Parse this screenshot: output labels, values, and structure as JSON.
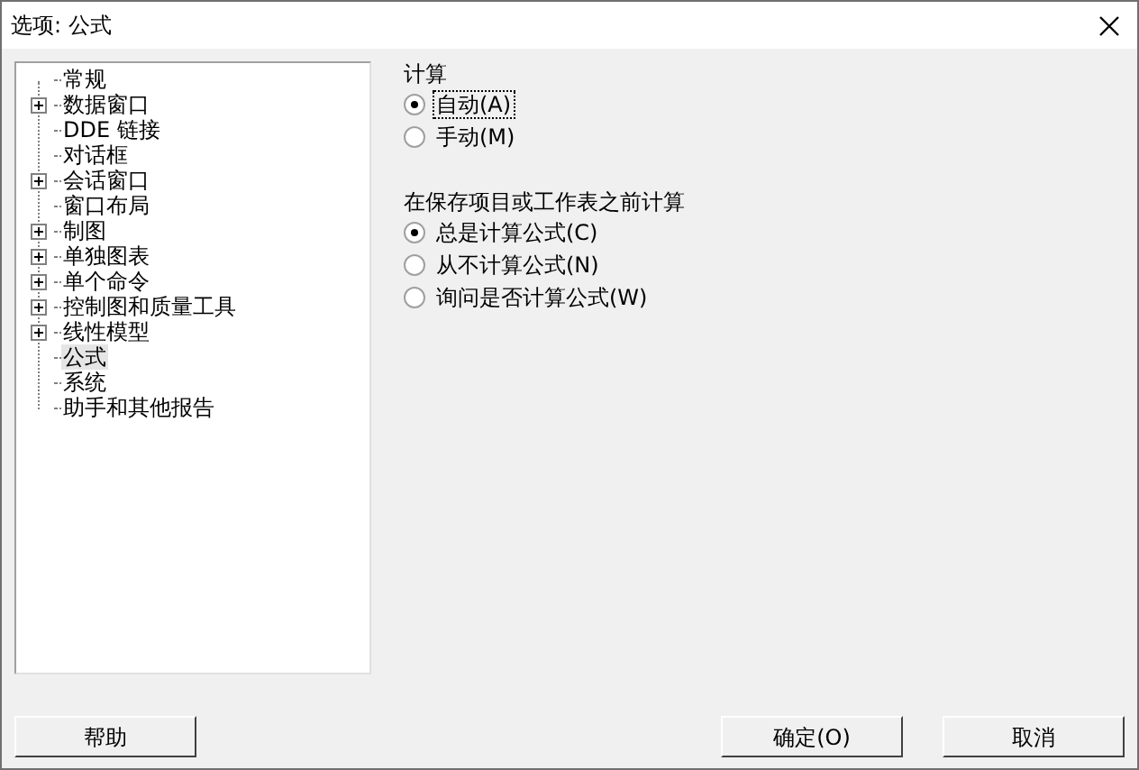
{
  "window": {
    "title": "选项: 公式"
  },
  "tree": {
    "items": [
      {
        "label": "常规",
        "expandable": false,
        "selected": false
      },
      {
        "label": "数据窗口",
        "expandable": true,
        "selected": false
      },
      {
        "label": "DDE 链接",
        "expandable": false,
        "selected": false
      },
      {
        "label": "对话框",
        "expandable": false,
        "selected": false
      },
      {
        "label": "会话窗口",
        "expandable": true,
        "selected": false
      },
      {
        "label": "窗口布局",
        "expandable": false,
        "selected": false
      },
      {
        "label": "制图",
        "expandable": true,
        "selected": false
      },
      {
        "label": "单独图表",
        "expandable": true,
        "selected": false
      },
      {
        "label": "单个命令",
        "expandable": true,
        "selected": false
      },
      {
        "label": "控制图和质量工具",
        "expandable": true,
        "selected": false
      },
      {
        "label": "线性模型",
        "expandable": true,
        "selected": false
      },
      {
        "label": "公式",
        "expandable": false,
        "selected": true
      },
      {
        "label": "系统",
        "expandable": false,
        "selected": false
      },
      {
        "label": "助手和其他报告",
        "expandable": false,
        "selected": false
      }
    ]
  },
  "sections": [
    {
      "heading": "计算",
      "options": [
        {
          "label": "自动(A)",
          "selected": true,
          "focused": true
        },
        {
          "label": "手动(M)",
          "selected": false,
          "focused": false
        }
      ]
    },
    {
      "heading": "在保存项目或工作表之前计算",
      "options": [
        {
          "label": "总是计算公式(C)",
          "selected": true,
          "focused": false
        },
        {
          "label": "从不计算公式(N)",
          "selected": false,
          "focused": false
        },
        {
          "label": "询问是否计算公式(W)",
          "selected": false,
          "focused": false
        }
      ]
    }
  ],
  "buttons": {
    "help": "帮助",
    "ok": "确定(O)",
    "cancel": "取消"
  }
}
